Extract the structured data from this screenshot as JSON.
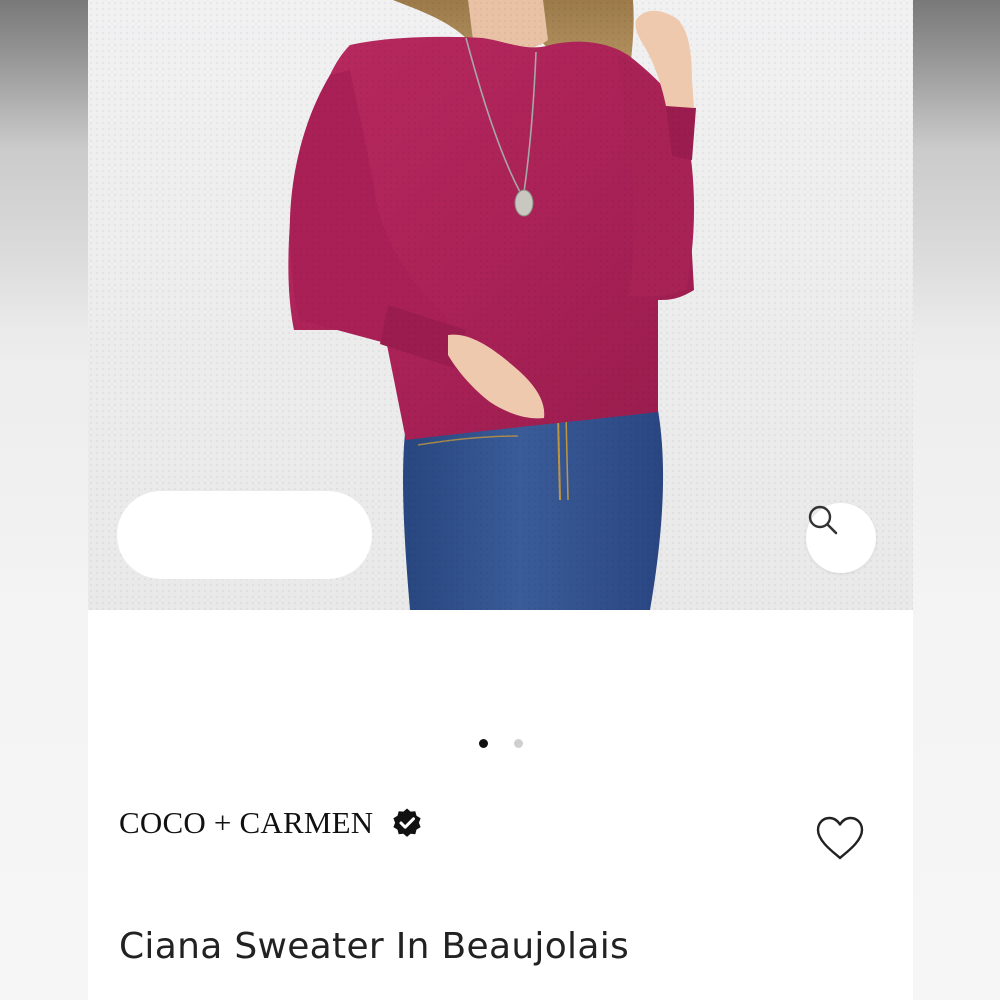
{
  "brand": {
    "name": "COCO + CARMEN",
    "verified_icon": "verified-badge-icon"
  },
  "product": {
    "title": "Ciana Sweater In Beaujolais",
    "sweater_color": "#b1265a",
    "jeans_color": "#2f4f8c"
  },
  "gallery": {
    "image_count": 2,
    "active_index": 0,
    "zoom_icon": "search-icon"
  },
  "actions": {
    "like_icon": "heart-icon"
  }
}
